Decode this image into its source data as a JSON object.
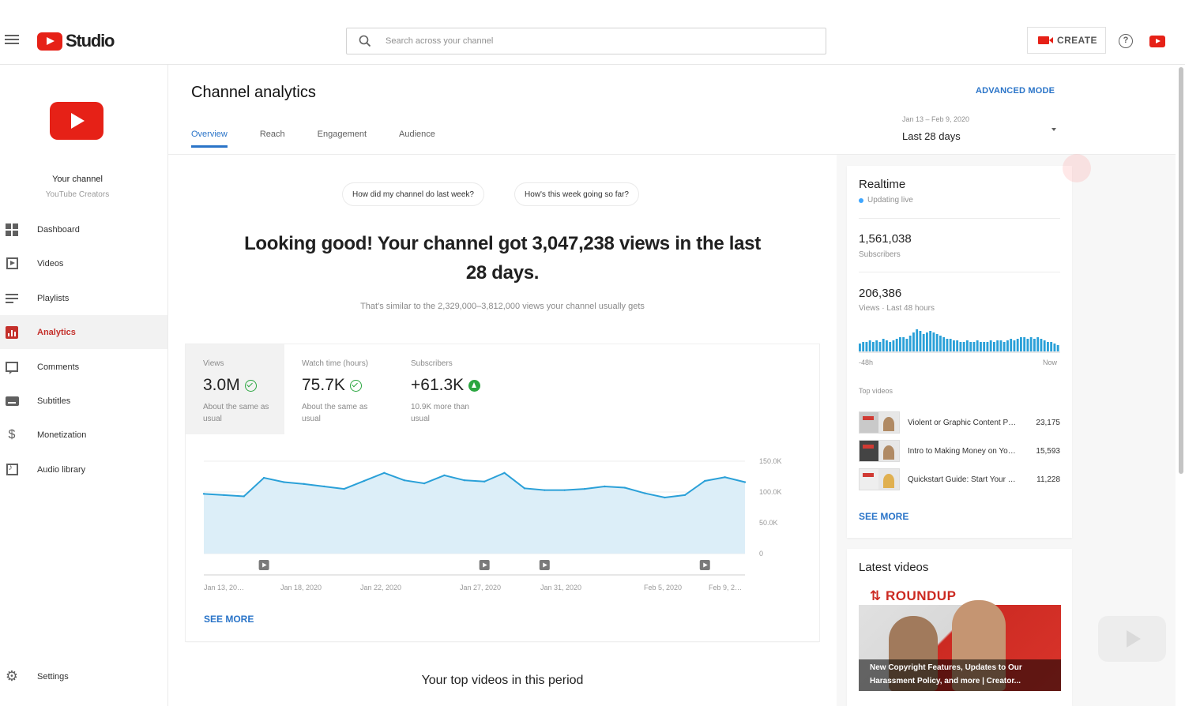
{
  "app": {
    "name": "Studio"
  },
  "header": {
    "search_placeholder": "Search across your channel",
    "create_label": "CREATE",
    "help_glyph": "?"
  },
  "sidebar": {
    "channel_name": "Your channel",
    "channel_sub": "YouTube Creators",
    "items": [
      {
        "label": "Dashboard",
        "icon": "dashboard-icon",
        "active": false
      },
      {
        "label": "Videos",
        "icon": "videos-icon",
        "active": false
      },
      {
        "label": "Playlists",
        "icon": "playlists-icon",
        "active": false
      },
      {
        "label": "Analytics",
        "icon": "analytics-icon",
        "active": true
      },
      {
        "label": "Comments",
        "icon": "comments-icon",
        "active": false
      },
      {
        "label": "Subtitles",
        "icon": "subtitles-icon",
        "active": false
      },
      {
        "label": "Monetization",
        "icon": "monetization-icon",
        "active": false
      },
      {
        "label": "Audio library",
        "icon": "audio-library-icon",
        "active": false
      }
    ],
    "settings_label": "Settings"
  },
  "main": {
    "title": "Channel analytics",
    "advanced_mode": "ADVANCED MODE",
    "tabs": [
      {
        "label": "Overview",
        "active": true
      },
      {
        "label": "Reach",
        "active": false
      },
      {
        "label": "Engagement",
        "active": false
      },
      {
        "label": "Audience",
        "active": false
      }
    ],
    "date_range": "Jan 13 – Feb 9, 2020",
    "date_label": "Last 28 days",
    "chips": [
      "How did my channel do last week?",
      "How's this week going so far?"
    ],
    "headline": "Looking good! Your channel got 3,047,238 views in the last 28 days.",
    "headline_sub": "That's similar to the 2,329,000–3,812,000 views your channel usually gets",
    "metrics": [
      {
        "label": "Views",
        "value": "3.0M",
        "note": "About the same as usual",
        "status": "check"
      },
      {
        "label": "Watch time (hours)",
        "value": "75.7K",
        "note": "About the same as usual",
        "status": "check"
      },
      {
        "label": "Subscribers",
        "value": "+61.3K",
        "note": "10.9K more than usual",
        "status": "up"
      }
    ],
    "see_more": "SEE MORE",
    "top_videos_title": "Your top videos in this period"
  },
  "chart_data": {
    "type": "area",
    "series": [
      {
        "name": "Views",
        "values": [
          97,
          95,
          93,
          123,
          116,
          113,
          109,
          105,
          118,
          131,
          119,
          114,
          127,
          119,
          117,
          131,
          106,
          103,
          103,
          105,
          109,
          107,
          98,
          91,
          95,
          118,
          124,
          116
        ]
      }
    ],
    "x_tick_labels": [
      "Jan 13, 20…",
      "Jan 18, 2020",
      "Jan 22, 2020",
      "Jan 27, 2020",
      "Jan 31, 2020",
      "Feb 5, 2020",
      "Feb 9, 2…"
    ],
    "y_tick_labels": [
      "150.0K",
      "100.0K",
      "50.0K",
      "0"
    ],
    "ylim": [
      0,
      150
    ],
    "grid": true,
    "video_markers": [
      3,
      14,
      17,
      25
    ],
    "colors": {
      "line": "#2aa0d8",
      "fill": "#dceef8"
    }
  },
  "realtime": {
    "title": "Realtime",
    "status": "Updating live",
    "subscribers_value": "1,561,038",
    "subscribers_label": "Subscribers",
    "views_value": "206,386",
    "views_label": "Views · Last 48 hours",
    "axis_start": "-48h",
    "axis_end": "Now",
    "bars": [
      5,
      6,
      6,
      7,
      6,
      7,
      6,
      8,
      7,
      6,
      7,
      8,
      9,
      9,
      8,
      10,
      12,
      14,
      13,
      11,
      12,
      13,
      12,
      11,
      10,
      9,
      8,
      8,
      7,
      7,
      6,
      6,
      7,
      6,
      6,
      7,
      6,
      6,
      6,
      7,
      6,
      7,
      7,
      6,
      7,
      8,
      7,
      8,
      9,
      9,
      8,
      9,
      8,
      9,
      8,
      7,
      6,
      6,
      5,
      4
    ],
    "top_videos_label": "Top videos",
    "top_videos": [
      {
        "title": "Violent or Graphic Content Policies",
        "views": "23,175"
      },
      {
        "title": "Intro to Making Money on YouTube",
        "views": "15,593"
      },
      {
        "title": "Quickstart Guide: Start Your YouTube Channel",
        "views": "11,228"
      }
    ],
    "see_more": "SEE MORE"
  },
  "latest_videos": {
    "title": "Latest videos",
    "thumb_title": "ROUNDUP",
    "thumb_caption": "New Copyright Features, Updates to Our Harassment Policy, and more | Creator..."
  }
}
